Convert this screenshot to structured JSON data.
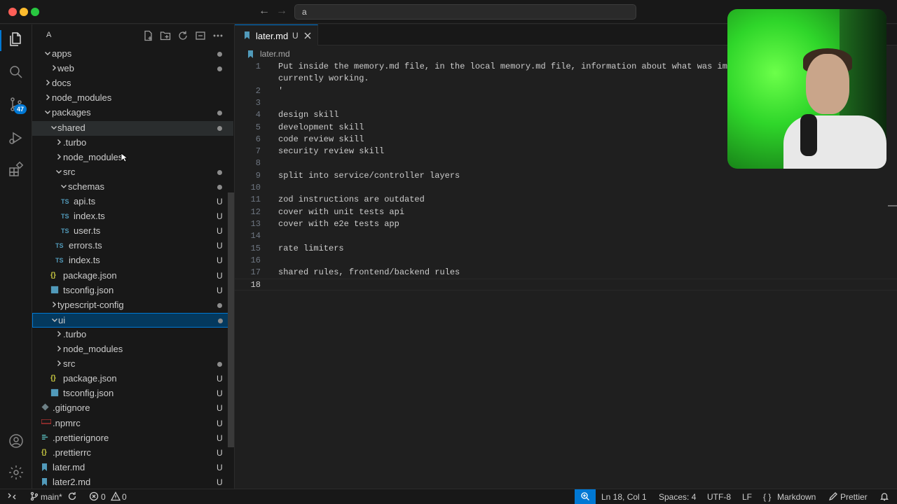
{
  "titlebar": {
    "command_center_text": "a"
  },
  "activity_bar": {
    "source_control_badge": "47"
  },
  "explorer": {
    "title": "A",
    "items": [
      {
        "label": "apps",
        "type": "folder",
        "expanded": true,
        "depth": 0,
        "status": "dot"
      },
      {
        "label": "web",
        "type": "folder",
        "expanded": false,
        "depth": 1,
        "status": "dot"
      },
      {
        "label": "docs",
        "type": "folder",
        "expanded": false,
        "depth": 0,
        "status": ""
      },
      {
        "label": "node_modules",
        "type": "folder",
        "expanded": false,
        "depth": 0,
        "status": ""
      },
      {
        "label": "packages",
        "type": "folder",
        "expanded": true,
        "depth": 0,
        "status": "dot"
      },
      {
        "label": "shared",
        "type": "folder",
        "expanded": true,
        "depth": 1,
        "status": "dot"
      },
      {
        "label": ".turbo",
        "type": "folder",
        "expanded": false,
        "depth": 2,
        "status": ""
      },
      {
        "label": "node_modules",
        "type": "folder",
        "expanded": false,
        "depth": 2,
        "status": ""
      },
      {
        "label": "src",
        "type": "folder",
        "expanded": true,
        "depth": 2,
        "status": "dot"
      },
      {
        "label": "schemas",
        "type": "folder",
        "expanded": true,
        "depth": 3,
        "status": "dot"
      },
      {
        "label": "api.ts",
        "type": "ts",
        "depth": 4,
        "status": "U"
      },
      {
        "label": "index.ts",
        "type": "ts",
        "depth": 4,
        "status": "U"
      },
      {
        "label": "user.ts",
        "type": "ts",
        "depth": 4,
        "status": "U"
      },
      {
        "label": "errors.ts",
        "type": "ts",
        "depth": 3,
        "status": "U"
      },
      {
        "label": "index.ts",
        "type": "ts",
        "depth": 3,
        "status": "U"
      },
      {
        "label": "package.json",
        "type": "json",
        "depth": 2,
        "status": "U"
      },
      {
        "label": "tsconfig.json",
        "type": "tsconfig",
        "depth": 2,
        "status": "U"
      },
      {
        "label": "typescript-config",
        "type": "folder",
        "expanded": false,
        "depth": 1,
        "status": "dot"
      },
      {
        "label": "ui",
        "type": "folder",
        "expanded": true,
        "depth": 1,
        "status": "dot"
      },
      {
        "label": ".turbo",
        "type": "folder",
        "expanded": false,
        "depth": 2,
        "status": ""
      },
      {
        "label": "node_modules",
        "type": "folder",
        "expanded": false,
        "depth": 2,
        "status": ""
      },
      {
        "label": "src",
        "type": "folder",
        "expanded": false,
        "depth": 2,
        "status": "dot"
      },
      {
        "label": "package.json",
        "type": "json",
        "depth": 2,
        "status": "U"
      },
      {
        "label": "tsconfig.json",
        "type": "tsconfig",
        "depth": 2,
        "status": "U"
      },
      {
        "label": ".gitignore",
        "type": "git",
        "depth": 0,
        "status": "U"
      },
      {
        "label": ".npmrc",
        "type": "npm",
        "depth": 0,
        "status": "U"
      },
      {
        "label": ".prettierignore",
        "type": "prettier",
        "depth": 0,
        "status": "U"
      },
      {
        "label": ".prettierrc",
        "type": "json",
        "depth": 0,
        "status": "U"
      },
      {
        "label": "later.md",
        "type": "md",
        "depth": 0,
        "status": "U"
      },
      {
        "label": "later2.md",
        "type": "md",
        "depth": 0,
        "status": "U"
      }
    ]
  },
  "editor": {
    "tab_label": "later.md",
    "tab_status": "U",
    "breadcrumb": "later.md",
    "lines": [
      {
        "n": "1",
        "text": "Put inside the memory.md file, in the local memory.md file, information about what was implem"
      },
      {
        "n": "",
        "text": "currently working."
      },
      {
        "n": "2",
        "text": "'"
      },
      {
        "n": "3",
        "text": ""
      },
      {
        "n": "4",
        "text": "design skill"
      },
      {
        "n": "5",
        "text": "development skill"
      },
      {
        "n": "6",
        "text": "code review skill"
      },
      {
        "n": "7",
        "text": "security review skill"
      },
      {
        "n": "8",
        "text": ""
      },
      {
        "n": "9",
        "text": "split into service/controller layers"
      },
      {
        "n": "10",
        "text": ""
      },
      {
        "n": "11",
        "text": "zod instructions are outdated"
      },
      {
        "n": "12",
        "text": "cover with unit tests api"
      },
      {
        "n": "13",
        "text": "cover with e2e tests app"
      },
      {
        "n": "14",
        "text": ""
      },
      {
        "n": "15",
        "text": "rate limiters"
      },
      {
        "n": "16",
        "text": ""
      },
      {
        "n": "17",
        "text": "shared rules, frontend/backend rules"
      },
      {
        "n": "18",
        "text": ""
      }
    ]
  },
  "statusbar": {
    "branch": "main*",
    "errors": "0",
    "warnings": "0",
    "cursor_position": "Ln 18, Col 1",
    "indent": "Spaces: 4",
    "encoding": "UTF-8",
    "eol": "LF",
    "language_braces": "{ }",
    "language": "Markdown",
    "formatter": "Prettier"
  },
  "colors": {
    "accent": "#0078d4",
    "ts_icon": "#519aba",
    "json_icon": "#cbcb41",
    "md_icon": "#519aba",
    "npm_icon": "#cb3837",
    "git_icon": "#6d8086"
  }
}
